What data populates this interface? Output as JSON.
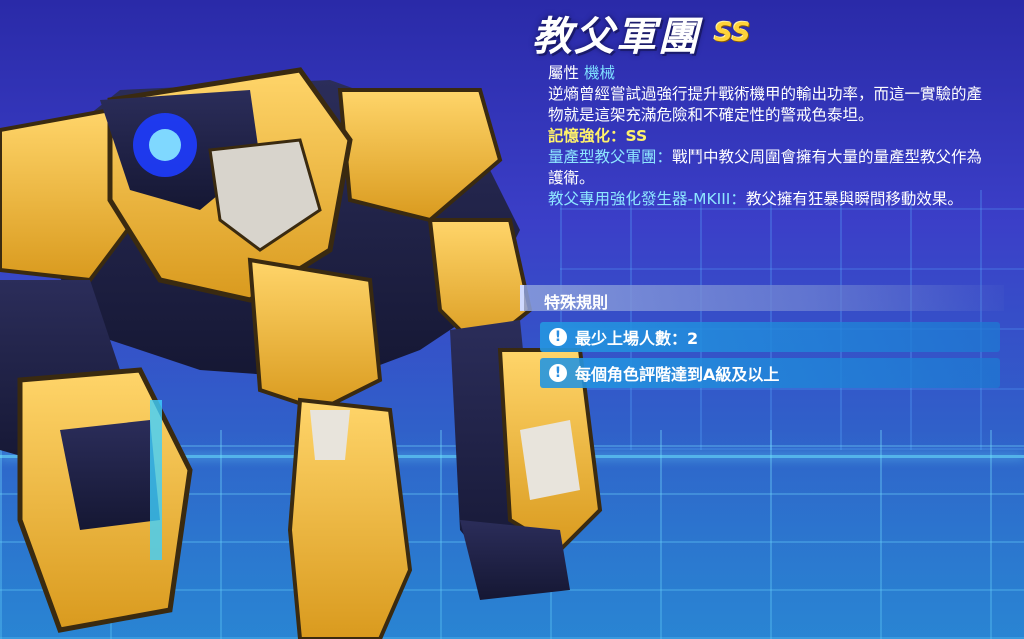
{
  "unit": {
    "name": "教父軍團",
    "rank": "SS"
  },
  "info": {
    "attribute_label": "屬性",
    "attribute_value": "機械",
    "description": "逆熵曾經嘗試過強行提升戰術機甲的輸出功率，而這一實驗的產物就是這架充滿危險和不確定性的警戒色泰坦。",
    "memory_label": "記憶強化：",
    "memory_value": "SS",
    "skill1_name": "量產型教父軍團：",
    "skill1_desc": "戰鬥中教父周圍會擁有大量的量產型教父作為護衛。",
    "skill2_name": "教父專用強化發生器-MKIII：",
    "skill2_desc": "教父擁有狂暴與瞬間移動效果。"
  },
  "rules": {
    "title": "特殊規則",
    "items": [
      {
        "icon": "exclamation-icon",
        "text": "最少上場人數：2"
      },
      {
        "icon": "exclamation-icon",
        "text": "每個角色評階達到A級及以上"
      }
    ]
  },
  "colors": {
    "accent_yellow": "#fff26a",
    "accent_blue": "#8ee6ff",
    "rank_gold": "#ffd23a"
  }
}
